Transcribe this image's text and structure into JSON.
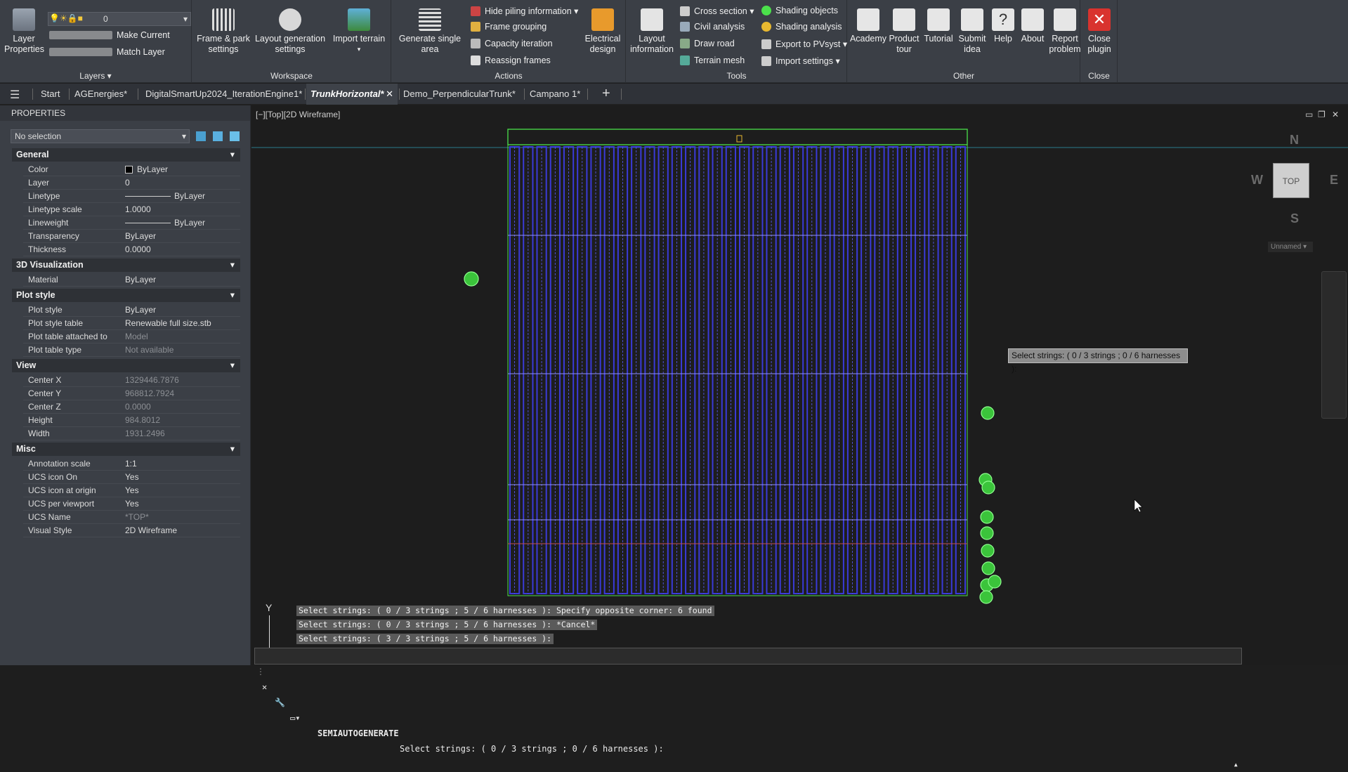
{
  "ribbon": {
    "layers": {
      "group": "Layers",
      "properties": "Layer\nProperties",
      "layer_value": "0",
      "make_current": "Make Current",
      "match_layer": "Match Layer"
    },
    "workspace": {
      "group": "Workspace",
      "frame_park": "Frame & park\nsettings",
      "layout_gen": "Layout generation\nsettings",
      "import_terrain": "Import terrain"
    },
    "actions": {
      "group": "Actions",
      "generate_single": "Generate single\narea",
      "hide_piling": "Hide piling information",
      "frame_grouping": "Frame grouping",
      "capacity_iteration": "Capacity iteration",
      "reassign_frames": "Reassign frames",
      "electrical": "Electrical\ndesign"
    },
    "tools": {
      "group": "Tools",
      "layout_info": "Layout\ninformation",
      "cross_section": "Cross section",
      "civil_analysis": "Civil analysis",
      "draw_road": "Draw road",
      "terrain_mesh": "Terrain mesh",
      "shading_objects": "Shading objects",
      "shading_analysis": "Shading analysis",
      "export_pvsyst": "Export to PVsyst",
      "import_settings": "Import settings"
    },
    "other": {
      "group": "Other",
      "academy": "Academy",
      "product_tour": "Product\ntour",
      "tutorial": "Tutorial",
      "submit_idea": "Submit\nidea",
      "help": "Help",
      "about": "About",
      "report": "Report\nproblem"
    },
    "close": {
      "group": "Close",
      "close_plugin": "Close\nplugin"
    }
  },
  "tabs": [
    "Start",
    "AGEnergies*",
    "DigitalSmartUp2024_IterationEngine1*",
    "TrunkHorizontal*",
    "Demo_PerpendicularTrunk*",
    "Campano 1*"
  ],
  "properties": {
    "title": "PROPERTIES",
    "selection": "No selection",
    "sections": {
      "general": "General",
      "viz": "3D Visualization",
      "plot": "Plot style",
      "view": "View",
      "misc": "Misc"
    },
    "general": [
      [
        "Color",
        "ByLayer"
      ],
      [
        "Layer",
        "0"
      ],
      [
        "Linetype",
        "ByLayer"
      ],
      [
        "Linetype scale",
        "1.0000"
      ],
      [
        "Lineweight",
        "ByLayer"
      ],
      [
        "Transparency",
        "ByLayer"
      ],
      [
        "Thickness",
        "0.0000"
      ]
    ],
    "viz": [
      [
        "Material",
        "ByLayer"
      ]
    ],
    "plot": [
      [
        "Plot style",
        "ByLayer"
      ],
      [
        "Plot style table",
        "Renewable full size.stb"
      ],
      [
        "Plot table attached to",
        "Model"
      ],
      [
        "Plot table type",
        "Not available"
      ]
    ],
    "view": [
      [
        "Center X",
        "1329446.7876"
      ],
      [
        "Center Y",
        "968812.7924"
      ],
      [
        "Center Z",
        "0.0000"
      ],
      [
        "Height",
        "984.8012"
      ],
      [
        "Width",
        "1931.2496"
      ]
    ],
    "misc": [
      [
        "Annotation scale",
        "1:1"
      ],
      [
        "UCS icon On",
        "Yes"
      ],
      [
        "UCS icon at origin",
        "Yes"
      ],
      [
        "UCS per viewport",
        "Yes"
      ],
      [
        "UCS Name",
        "*TOP*"
      ],
      [
        "Visual Style",
        "2D Wireframe"
      ]
    ]
  },
  "viewport": {
    "label": "[−][Top][2D Wireframe]",
    "tooltip": "Select strings: ( 0 / 3 strings ; 0 / 6 harnesses ):",
    "compass": {
      "n": "N",
      "s": "S",
      "e": "E",
      "w": "W",
      "top": "TOP",
      "ucs": "Unnamed"
    },
    "axis_y": "Y",
    "history": [
      "Select strings: ( 0 / 3 strings ; 5 / 6 harnesses ): Specify opposite corner: 6 found",
      "Select strings: ( 0 / 3 strings ; 5 / 6 harnesses ): *Cancel*",
      "Select strings: ( 3 / 3 strings ; 5 / 6 harnesses ):"
    ],
    "command": "SEMIAUTOGENERATE",
    "prompt": "Select strings: ( 0 / 3 strings ; 0 / 6 harnesses ):"
  },
  "colors": {
    "ribbon": "#3b3f46",
    "viewport": "#1d1d1d",
    "panel": "#3b3f46",
    "strings": "#3a3ad8",
    "accent_green": "#4be04b"
  }
}
